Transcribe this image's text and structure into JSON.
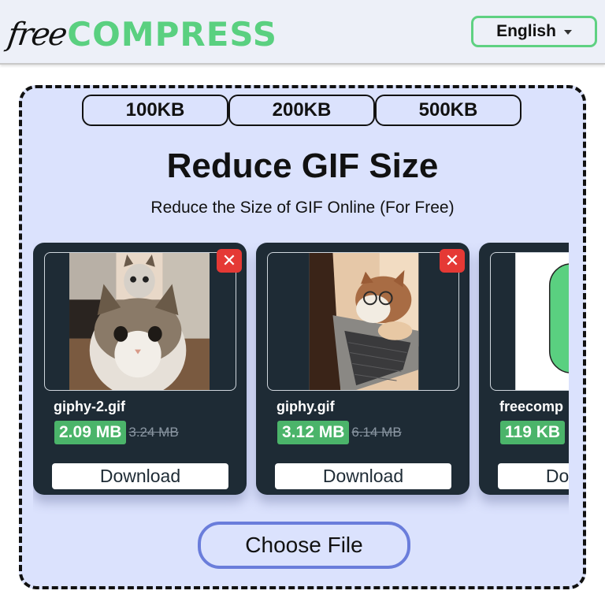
{
  "header": {
    "logo": {
      "free": "free",
      "compress": "COMPRESS"
    },
    "language": {
      "selected": "English",
      "icon": "caret-down-icon"
    }
  },
  "size_presets": [
    {
      "label": "100KB"
    },
    {
      "label": "200KB"
    },
    {
      "label": "500KB"
    }
  ],
  "main": {
    "title": "Reduce GIF Size",
    "subtitle": "Reduce the Size of GIF Online (For Free)"
  },
  "files": [
    {
      "name": "giphy-2.gif",
      "new_size": "2.09 MB",
      "old_size": "3.24 MB",
      "download_label": "Download",
      "remove_label": "✕",
      "thumbnail": "cats-staring"
    },
    {
      "name": "giphy.gif",
      "new_size": "3.12 MB",
      "old_size": "6.14 MB",
      "download_label": "Download",
      "remove_label": "✕",
      "thumbnail": "cat-with-glasses-laptop"
    },
    {
      "name": "freecomp",
      "new_size": "119 KB",
      "old_size": "",
      "download_label": "Download",
      "remove_label": "✕",
      "thumbnail": "green-shape"
    }
  ],
  "choose_file_label": "Choose File",
  "colors": {
    "brand_green": "#5ad080",
    "panel_bg": "#dbe2fd",
    "card_bg": "#1e2b35",
    "size_badge": "#4bb46a",
    "remove_red": "#e53935",
    "choose_border": "#6a7ddb"
  }
}
